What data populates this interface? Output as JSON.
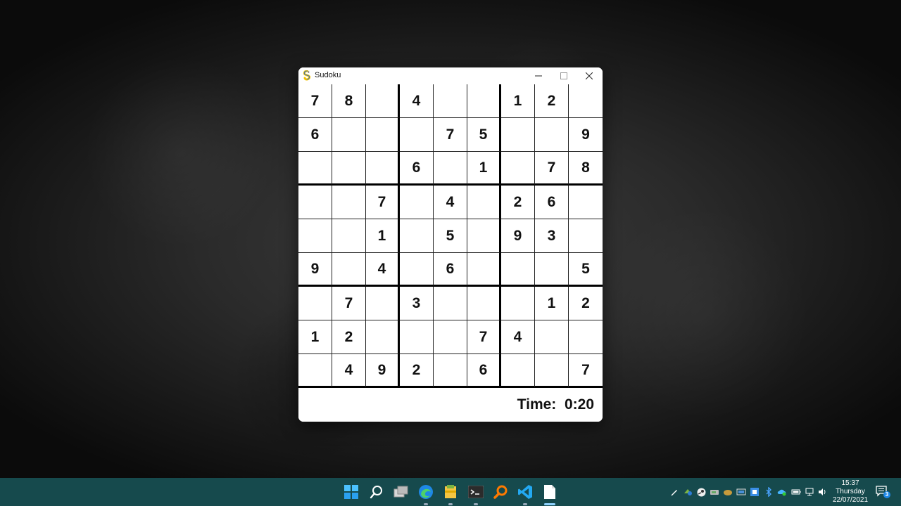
{
  "window": {
    "title": "Sudoku",
    "icon": "pygame-snake-icon"
  },
  "board": [
    [
      "7",
      "8",
      "",
      "4",
      "",
      "",
      "1",
      "2",
      ""
    ],
    [
      "6",
      "",
      "",
      "",
      "7",
      "5",
      "",
      "",
      "9"
    ],
    [
      "",
      "",
      "",
      "6",
      "",
      "1",
      "",
      "7",
      "8"
    ],
    [
      "",
      "",
      "7",
      "",
      "4",
      "",
      "2",
      "6",
      ""
    ],
    [
      "",
      "",
      "1",
      "",
      "5",
      "",
      "9",
      "3",
      ""
    ],
    [
      "9",
      "",
      "4",
      "",
      "6",
      "",
      "",
      "",
      "5"
    ],
    [
      "",
      "7",
      "",
      "3",
      "",
      "",
      "",
      "1",
      "2"
    ],
    [
      "1",
      "2",
      "",
      "",
      "",
      "7",
      "4",
      "",
      ""
    ],
    [
      "",
      "4",
      "9",
      "2",
      "",
      "6",
      "",
      "",
      "7"
    ]
  ],
  "status": {
    "time_label": "Time:  0:20"
  },
  "taskbar": {
    "apps": [
      "start-icon",
      "search-icon",
      "task-view-icon",
      "edge-icon",
      "file-explorer-icon",
      "terminal-icon",
      "search-everything-icon",
      "vscode-icon",
      "notepad-icon"
    ],
    "clock": {
      "time": "15:37",
      "day": "Thursday",
      "date": "22/07/2021"
    },
    "notifications_count": "3"
  },
  "colors": {
    "taskbar": "#164a4d",
    "window_bg": "#ffffff",
    "text": "#111111"
  }
}
